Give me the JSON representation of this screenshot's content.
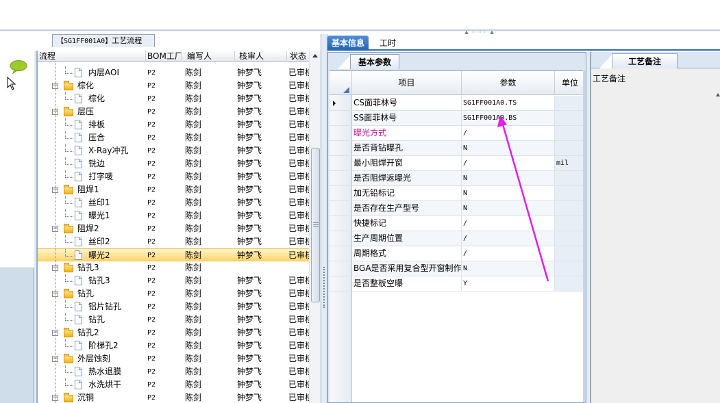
{
  "process_panel": {
    "title_code": "【SG1FF001A0】",
    "title_text": "工艺流程"
  },
  "tree": {
    "columns": [
      "流程",
      "BOM工厂",
      "编写人",
      "核审人",
      "状态"
    ],
    "rows": [
      {
        "name": "内层AOI",
        "type": "doc",
        "level": 1,
        "bom": "P2",
        "writer": "陈剑",
        "reviewer": "钟梦飞",
        "status": "已审核"
      },
      {
        "name": "棕化",
        "type": "folder",
        "level": 0,
        "bom": "P2",
        "writer": "陈剑",
        "reviewer": "钟梦飞",
        "status": "已审核"
      },
      {
        "name": "棕化",
        "type": "doc",
        "level": 1,
        "bom": "P2",
        "writer": "陈剑",
        "reviewer": "钟梦飞",
        "status": "已审核"
      },
      {
        "name": "层压",
        "type": "folder",
        "level": 0,
        "bom": "P2",
        "writer": "陈剑",
        "reviewer": "钟梦飞",
        "status": "已审核"
      },
      {
        "name": "排板",
        "type": "doc",
        "level": 1,
        "bom": "P2",
        "writer": "陈剑",
        "reviewer": "钟梦飞",
        "status": "已审核"
      },
      {
        "name": "压合",
        "type": "doc",
        "level": 1,
        "bom": "P2",
        "writer": "陈剑",
        "reviewer": "钟梦飞",
        "status": "已审核"
      },
      {
        "name": "X-Ray冲孔",
        "type": "doc",
        "level": 1,
        "bom": "P2",
        "writer": "陈剑",
        "reviewer": "钟梦飞",
        "status": "已审核"
      },
      {
        "name": "铣边",
        "type": "doc",
        "level": 1,
        "bom": "P2",
        "writer": "陈剑",
        "reviewer": "钟梦飞",
        "status": "已审核"
      },
      {
        "name": "打字唛",
        "type": "doc",
        "level": 1,
        "bom": "P2",
        "writer": "陈剑",
        "reviewer": "钟梦飞",
        "status": "已审核"
      },
      {
        "name": "阻焊1",
        "type": "folder",
        "level": 0,
        "bom": "P2",
        "writer": "陈剑",
        "reviewer": "钟梦飞",
        "status": "已审核"
      },
      {
        "name": "丝印1",
        "type": "doc",
        "level": 1,
        "bom": "P2",
        "writer": "陈剑",
        "reviewer": "钟梦飞",
        "status": "已审核"
      },
      {
        "name": "曝光1",
        "type": "doc",
        "level": 1,
        "bom": "P2",
        "writer": "陈剑",
        "reviewer": "钟梦飞",
        "status": "已审核"
      },
      {
        "name": "阻焊2",
        "type": "folder",
        "level": 0,
        "bom": "P2",
        "writer": "陈剑",
        "reviewer": "钟梦飞",
        "status": "已审核"
      },
      {
        "name": "丝印2",
        "type": "doc",
        "level": 1,
        "bom": "P2",
        "writer": "陈剑",
        "reviewer": "钟梦飞",
        "status": "已审核"
      },
      {
        "name": "曝光2",
        "type": "doc",
        "level": 1,
        "bom": "P2",
        "writer": "陈剑",
        "reviewer": "钟梦飞",
        "status": "已审核",
        "selected": true
      },
      {
        "name": "钻孔3",
        "type": "folder",
        "level": 0,
        "bom": "P2",
        "writer": "陈剑",
        "reviewer": "",
        "status": ""
      },
      {
        "name": "钻孔3",
        "type": "doc",
        "level": 1,
        "bom": "P2",
        "writer": "陈剑",
        "reviewer": "钟梦飞",
        "status": "已审核"
      },
      {
        "name": "钻孔",
        "type": "folder",
        "level": 0,
        "bom": "P2",
        "writer": "陈剑",
        "reviewer": "钟梦飞",
        "status": "已审核"
      },
      {
        "name": "铝片钻孔",
        "type": "doc",
        "level": 1,
        "bom": "P2",
        "writer": "陈剑",
        "reviewer": "钟梦飞",
        "status": "已审核"
      },
      {
        "name": "钻孔",
        "type": "doc",
        "level": 1,
        "bom": "P2",
        "writer": "陈剑",
        "reviewer": "钟梦飞",
        "status": "已审核"
      },
      {
        "name": "钻孔2",
        "type": "folder",
        "level": 0,
        "bom": "P2",
        "writer": "陈剑",
        "reviewer": "钟梦飞",
        "status": "已审核"
      },
      {
        "name": "阶梯孔2",
        "type": "doc",
        "level": 1,
        "bom": "P2",
        "writer": "陈剑",
        "reviewer": "钟梦飞",
        "status": "已审核"
      },
      {
        "name": "外层蚀刻",
        "type": "folder",
        "level": 0,
        "bom": "P2",
        "writer": "陈剑",
        "reviewer": "钟梦飞",
        "status": "已审核"
      },
      {
        "name": "热水退膜",
        "type": "doc",
        "level": 1,
        "bom": "P2",
        "writer": "陈剑",
        "reviewer": "钟梦飞",
        "status": "已审核"
      },
      {
        "name": "水洗烘干",
        "type": "doc",
        "level": 1,
        "bom": "P2",
        "writer": "陈剑",
        "reviewer": "钟梦飞",
        "status": "已审核"
      },
      {
        "name": "沉铜",
        "type": "folder",
        "level": 0,
        "bom": "P2",
        "writer": "陈剑",
        "reviewer": "钟梦飞",
        "status": "已审核"
      }
    ]
  },
  "right_tabs": {
    "basic_info": "基本信息",
    "work_hours": "工时"
  },
  "params": {
    "subtab": "基本参数",
    "headers": {
      "item": "项目",
      "param": "参数",
      "unit": "单位"
    },
    "rows": [
      {
        "item": "CS面菲林号",
        "param": "SG1FF001A0.TS",
        "unit": "",
        "current": true
      },
      {
        "item": "SS面菲林号",
        "param": "SG1FF001A0.BS",
        "unit": ""
      },
      {
        "item": "曝光方式",
        "param": "/",
        "unit": "",
        "highlight": true
      },
      {
        "item": "是否背钻曝孔",
        "param": "N",
        "unit": ""
      },
      {
        "item": "最小阻焊开窗",
        "param": "/",
        "unit": "mil"
      },
      {
        "item": "是否阻焊返曝光",
        "param": "N",
        "unit": ""
      },
      {
        "item": "加无铅标记",
        "param": "N",
        "unit": ""
      },
      {
        "item": "是否存在生产型号",
        "param": "N",
        "unit": ""
      },
      {
        "item": "快捷标记",
        "param": "/",
        "unit": ""
      },
      {
        "item": "生产周期位置",
        "param": "/",
        "unit": ""
      },
      {
        "item": "周期格式",
        "param": "/",
        "unit": ""
      },
      {
        "item": "BGA是否采用复合型开窗制作",
        "param": "N",
        "unit": ""
      },
      {
        "item": "是否整板空曝",
        "param": "Y",
        "unit": ""
      }
    ]
  },
  "notes": {
    "tab": "工艺备注",
    "label": "工艺备注"
  },
  "colors": {
    "selection": "#ffd66e",
    "accent_tab": "#2f6db6",
    "annotation_arrow": "#e01ee8",
    "highlight_text": "#b5179e"
  }
}
